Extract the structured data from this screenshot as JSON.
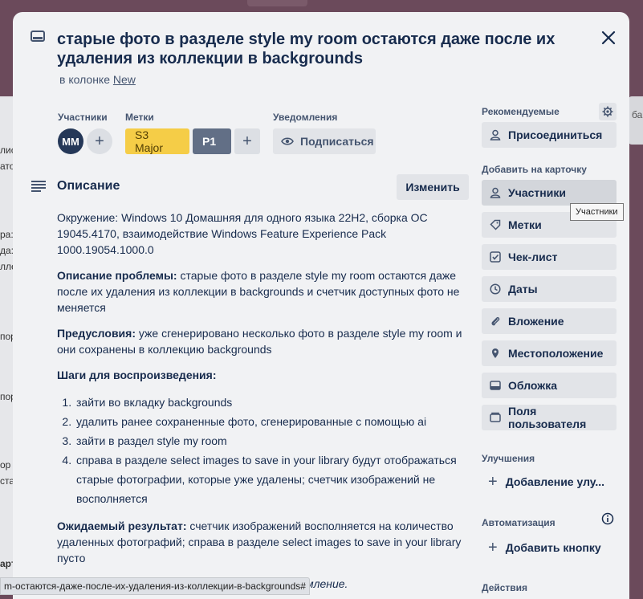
{
  "card": {
    "title": "старые фото в разделе style my room остаются даже после их удаления из коллекции в backgrounds",
    "in_list_prefix": "в колонке",
    "list_name": "New"
  },
  "members": {
    "label": "Участники",
    "avatar_initials": "MM"
  },
  "labels": {
    "label": "Метки",
    "items": [
      "S3 Major",
      "P1"
    ]
  },
  "notifications": {
    "label": "Уведомления",
    "subscribe": "Подписаться"
  },
  "description": {
    "title": "Описание",
    "edit": "Изменить",
    "environment": "Окружение: Windows 10 Домашняя для одного языка 22H2, сборка ОС 19045.4170, взаимодействие Windows Feature Experience Pack 1000.19054.1000.0",
    "problem_label": "Описание проблемы:",
    "problem_text": " старые фото в разделе style my room остаются даже после их удаления из коллекции в backgrounds и счетчик доступных фото не меняется",
    "precond_label": "Предусловия:",
    "precond_text": " уже сгенерировано несколько фото в разделе style my room и они сохранены в коллекцию backgrounds",
    "steps_label": "Шаги для воспроизведения:",
    "steps": [
      "зайти во вкладку backgrounds",
      "удалить ранее сохраненные фото, сгенерированные с помощью ai",
      "зайти в раздел style my room",
      "справа в разделе select images to save in your library будут отображаться старые фотографии, которые уже удалены; счетчик изображений не восполняется"
    ],
    "expected_label": "Ожидаемый результат:",
    "expected_text": " счетчик изображений восполняется на количество удаленных фотографий; справа в разделе select images to save in your library пусто",
    "cut_text": "мление."
  },
  "sidebar": {
    "recommended_label": "Рекомендуемые",
    "join": "Присоединиться",
    "add_to_card_label": "Добавить на карточку",
    "add_items": [
      "Участники",
      "Метки",
      "Чек-лист",
      "Даты",
      "Вложение",
      "Местоположение",
      "Обложка",
      "Поля пользователя"
    ],
    "powerups_label": "Улучшения",
    "add_powerup": "Добавление улу...",
    "automation_label": "Автоматизация",
    "add_button": "Добавить кнопку",
    "actions_label": "Действия"
  },
  "tooltip": "Участники",
  "status_url": "m-остаются-даже-после-их-удаления-из-коллекции-в-backgrounds#",
  "background": {
    "col_fragments": [
      "лис",
      "ато",
      "ра:",
      "да:",
      "лле",
      "пор",
      "пор",
      "ор",
      "ста",
      "арт"
    ],
    "right_fragment": "ба"
  }
}
